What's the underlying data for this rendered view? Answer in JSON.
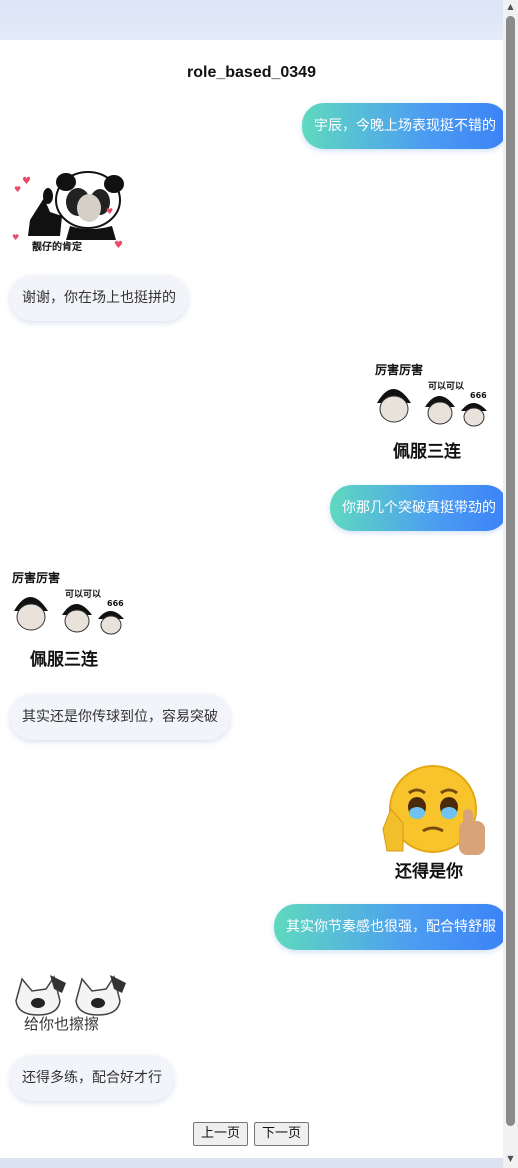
{
  "chat": {
    "title": "role_based_0349",
    "messages": [
      {
        "side": "right",
        "type": "text",
        "text": "宇辰，今晚上场表现挺不错的"
      },
      {
        "side": "left",
        "type": "sticker",
        "sticker": "panda-thumbs-up",
        "caption": "靓仔的肯定"
      },
      {
        "side": "left",
        "type": "text",
        "text": "谢谢，你在场上也挺拼的"
      },
      {
        "side": "right",
        "type": "sticker",
        "sticker": "bowl-cut-faces",
        "caption_top": "厉害厉害",
        "caption_mid": "可以可以",
        "caption_num": "666",
        "caption_bottom": "佩服三连"
      },
      {
        "side": "right",
        "type": "text",
        "text": "你那几个突破真挺带劲的"
      },
      {
        "side": "left",
        "type": "sticker",
        "sticker": "bowl-cut-faces",
        "caption_top": "厉害厉害",
        "caption_mid": "可以可以",
        "caption_num": "666",
        "caption_bottom": "佩服三连"
      },
      {
        "side": "left",
        "type": "text",
        "text": "其实还是你传球到位，容易突破"
      },
      {
        "side": "right",
        "type": "sticker",
        "sticker": "teary-emoji-thumbs-up",
        "caption": "还得是你"
      },
      {
        "side": "right",
        "type": "text",
        "text": "其实你节奏感也很强，配合特舒服"
      },
      {
        "side": "left",
        "type": "sticker",
        "sticker": "cats-wiping",
        "caption": "给你也擦擦"
      },
      {
        "side": "left",
        "type": "text",
        "text": "还得多练，配合好才行"
      }
    ]
  },
  "pager": {
    "prev_label": "上一页",
    "next_label": "下一页"
  },
  "colors": {
    "outgoing_gradient_start": "#5fd9bf",
    "outgoing_gradient_end": "#3b82f6",
    "incoming_bubble": "#f2f4f9",
    "page_background": "#dde6f7"
  }
}
